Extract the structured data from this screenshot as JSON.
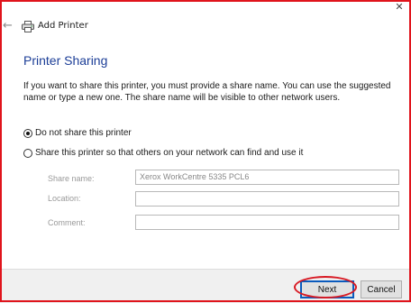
{
  "window": {
    "title": "Add Printer",
    "close_glyph": "✕",
    "back_glyph": "←"
  },
  "page": {
    "title": "Printer Sharing",
    "description": "If you want to share this printer, you must provide a share name. You can use the suggested name or type a new one. The share name will be visible to other network users."
  },
  "options": {
    "do_not_share": {
      "label": "Do not share this printer",
      "selected": true
    },
    "share": {
      "label": "Share this printer so that others on your network can find and use it",
      "selected": false
    }
  },
  "fields": {
    "share_name": {
      "label": "Share name:",
      "value": "Xerox WorkCentre 5335 PCL6"
    },
    "location": {
      "label": "Location:",
      "value": ""
    },
    "comment": {
      "label": "Comment:",
      "value": ""
    }
  },
  "buttons": {
    "next": "Next",
    "cancel": "Cancel"
  },
  "colors": {
    "title_blue": "#1c3e97",
    "annotation_red": "#e0141c",
    "default_button_border": "#0a5bbd"
  }
}
